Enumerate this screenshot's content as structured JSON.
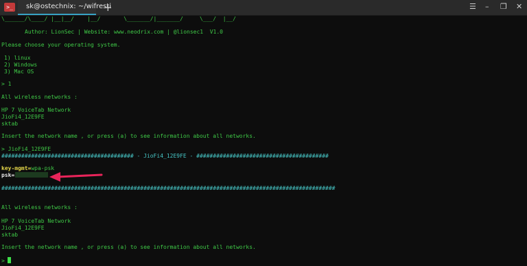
{
  "window": {
    "tab_title": "sk@ostechnix: ~/wifresti",
    "terminal_icon": ">_",
    "new_tab_icon": "+",
    "menu_icon": "☰",
    "minimize_icon": "–",
    "maximize_icon": "❐",
    "close_icon": "✕"
  },
  "terminal": {
    "ascii_tail": "\\______/\\____/ |__|__/    |__/       \\_______/|_______/     \\___/  |__/",
    "author": "Author: LionSec | Website: www.neodrix.com | @lionsec1  V1.0",
    "choose_os": "Please choose your operating system.",
    "os_options": [
      "1) linux",
      "2) Windows",
      "3) Mac OS"
    ],
    "prompt_choice": "> 1",
    "all_networks_heading": "All wireless networks :",
    "networks": [
      "HP 7 VoiceTab Network",
      "JioFi4_12E9FE",
      "sktab"
    ],
    "insert_prompt": "Insert the network name , or press (a) to see information about all networks.",
    "prompt_network": "> JioFi4_12E9FE",
    "hash_header": "######################################## - JioFi4_12E9FE - ########################################",
    "key_mgmt_key": "key-mgmt=",
    "key_mgmt_value": "wpa-psk",
    "psk_key": "psk=",
    "hash_footer": "#####################################################################################################",
    "all_networks_heading_2": "All wireless networks :",
    "networks_2": [
      "HP 7 VoiceTab Network",
      "JioFi4_12E9FE",
      "sktab"
    ],
    "insert_prompt_2": "Insert the network name , or press (a) to see information about all networks.",
    "final_prompt": ">"
  },
  "colors": {
    "text_green": "#3fc947",
    "hash_cyan": "#47c8c8",
    "key_yellow": "#e6d84a",
    "arrow_red": "#e8245a",
    "tab_accent": "#37a3c4"
  }
}
